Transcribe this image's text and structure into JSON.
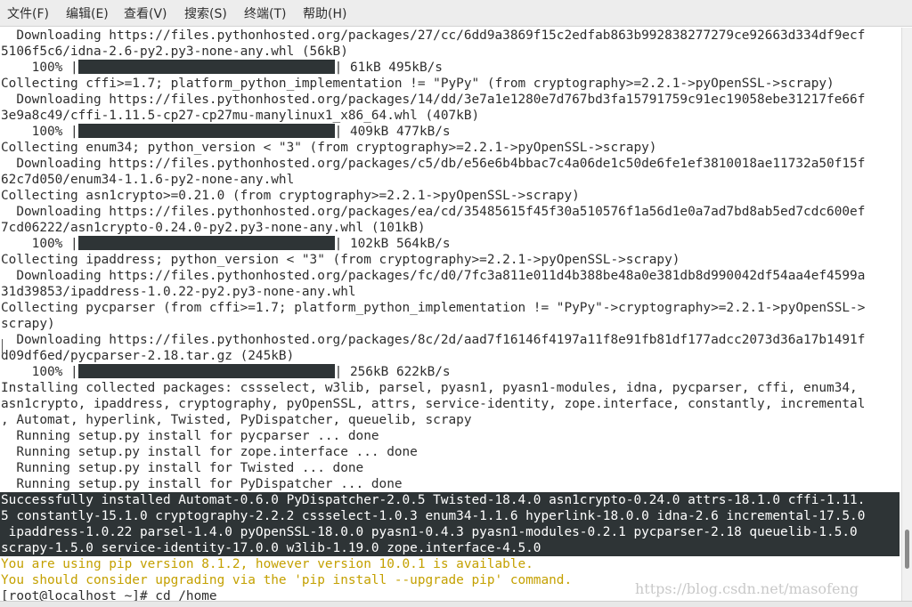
{
  "menubar": {
    "items": [
      "文件(F)",
      "编辑(E)",
      "查看(V)",
      "搜索(S)",
      "终端(T)",
      "帮助(H)"
    ]
  },
  "terminal": {
    "lines": [
      {
        "kind": "text",
        "text": "  Downloading https://files.pythonhosted.org/packages/27/cc/6dd9a3869f15c2edfab863b992838277279ce92663d334df9ecf"
      },
      {
        "kind": "text",
        "text": "5106f5c6/idna-2.6-py2.py3-none-any.whl (56kB)"
      },
      {
        "kind": "progress",
        "pct": "    100% |",
        "stats": "| 61kB 495kB/s"
      },
      {
        "kind": "text",
        "text": "Collecting cffi>=1.7; platform_python_implementation != \"PyPy\" (from cryptography>=2.2.1->pyOpenSSL->scrapy)"
      },
      {
        "kind": "text",
        "text": "  Downloading https://files.pythonhosted.org/packages/14/dd/3e7a1e1280e7d767bd3fa15791759c91ec19058ebe31217fe66f"
      },
      {
        "kind": "text",
        "text": "3e9a8c49/cffi-1.11.5-cp27-cp27mu-manylinux1_x86_64.whl (407kB)"
      },
      {
        "kind": "progress",
        "pct": "    100% |",
        "stats": "| 409kB 477kB/s"
      },
      {
        "kind": "text",
        "text": "Collecting enum34; python_version < \"3\" (from cryptography>=2.2.1->pyOpenSSL->scrapy)"
      },
      {
        "kind": "text",
        "text": "  Downloading https://files.pythonhosted.org/packages/c5/db/e56e6b4bbac7c4a06de1c50de6fe1ef3810018ae11732a50f15f"
      },
      {
        "kind": "text",
        "text": "62c7d050/enum34-1.1.6-py2-none-any.whl"
      },
      {
        "kind": "text",
        "text": "Collecting asn1crypto>=0.21.0 (from cryptography>=2.2.1->pyOpenSSL->scrapy)"
      },
      {
        "kind": "text",
        "text": "  Downloading https://files.pythonhosted.org/packages/ea/cd/35485615f45f30a510576f1a56d1e0a7ad7bd8ab5ed7cdc600ef"
      },
      {
        "kind": "text",
        "text": "7cd06222/asn1crypto-0.24.0-py2.py3-none-any.whl (101kB)"
      },
      {
        "kind": "progress",
        "pct": "    100% |",
        "stats": "| 102kB 564kB/s"
      },
      {
        "kind": "text",
        "text": "Collecting ipaddress; python_version < \"3\" (from cryptography>=2.2.1->pyOpenSSL->scrapy)"
      },
      {
        "kind": "text",
        "text": "  Downloading https://files.pythonhosted.org/packages/fc/d0/7fc3a811e011d4b388be48a0e381db8d990042df54aa4ef4599a"
      },
      {
        "kind": "text",
        "text": "31d39853/ipaddress-1.0.22-py2.py3-none-any.whl"
      },
      {
        "kind": "text",
        "text": "Collecting pycparser (from cffi>=1.7; platform_python_implementation != \"PyPy\"->cryptography>=2.2.1->pyOpenSSL->"
      },
      {
        "kind": "text",
        "text": "scrapy)"
      },
      {
        "kind": "text",
        "text": "  Downloading https://files.pythonhosted.org/packages/8c/2d/aad7f16146f4197a11f8e91fb81df177adcc2073d36a17b1491f"
      },
      {
        "kind": "text",
        "text": "d09df6ed/pycparser-2.18.tar.gz (245kB)"
      },
      {
        "kind": "progress",
        "pct": "    100% |",
        "stats": "| 256kB 622kB/s"
      },
      {
        "kind": "text",
        "text": "Installing collected packages: cssselect, w3lib, parsel, pyasn1, pyasn1-modules, idna, pycparser, cffi, enum34,"
      },
      {
        "kind": "text",
        "text": "asn1crypto, ipaddress, cryptography, pyOpenSSL, attrs, service-identity, zope.interface, constantly, incremental"
      },
      {
        "kind": "text",
        "text": ", Automat, hyperlink, Twisted, PyDispatcher, queuelib, scrapy"
      },
      {
        "kind": "text",
        "text": "  Running setup.py install for pycparser ... done"
      },
      {
        "kind": "text",
        "text": "  Running setup.py install for zope.interface ... done"
      },
      {
        "kind": "text",
        "text": "  Running setup.py install for Twisted ... done"
      },
      {
        "kind": "text",
        "text": "  Running setup.py install for PyDispatcher ... done"
      },
      {
        "kind": "hl",
        "text": "Successfully installed Automat-0.6.0 PyDispatcher-2.0.5 Twisted-18.4.0 asn1crypto-0.24.0 attrs-18.1.0 cffi-1.11."
      },
      {
        "kind": "hl",
        "text": "5 constantly-15.1.0 cryptography-2.2.2 cssselect-1.0.3 enum34-1.1.6 hyperlink-18.0.0 idna-2.6 incremental-17.5.0"
      },
      {
        "kind": "hl",
        "text": " ipaddress-1.0.22 parsel-1.4.0 pyOpenSSL-18.0.0 pyasn1-0.4.3 pyasn1-modules-0.2.1 pycparser-2.18 queuelib-1.5.0"
      },
      {
        "kind": "hl",
        "text": "scrapy-1.5.0 service-identity-17.0.0 w3lib-1.19.0 zope.interface-4.5.0"
      },
      {
        "kind": "warn",
        "text": "You are using pip version 8.1.2, however version 10.0.1 is available."
      },
      {
        "kind": "warn",
        "text": "You should consider upgrading via the 'pip install --upgrade pip' command."
      },
      {
        "kind": "text",
        "text": "[root@localhost ~]# cd /home"
      }
    ]
  },
  "watermark": "https://blog.csdn.net/masofeng"
}
